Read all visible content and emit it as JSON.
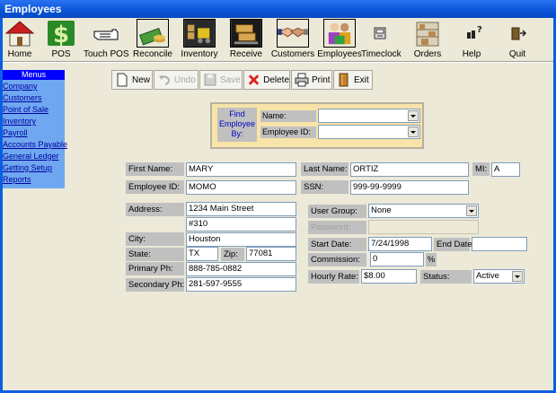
{
  "window": {
    "title": "Employees"
  },
  "toolbar": {
    "items": [
      {
        "label": "Home",
        "icon": "house-icon"
      },
      {
        "label": "POS",
        "icon": "dollar-icon"
      },
      {
        "label": "Touch POS",
        "icon": "pointing-hand-icon"
      },
      {
        "label": "Reconcile",
        "icon": "money-stack-icon"
      },
      {
        "label": "Inventory",
        "icon": "forklift-icon"
      },
      {
        "label": "Receive",
        "icon": "boxes-icon"
      },
      {
        "label": "Customers",
        "icon": "handshake-icon"
      },
      {
        "label": "Employees",
        "icon": "people-icon"
      },
      {
        "label": "Timeclock",
        "icon": "clock-icon"
      },
      {
        "label": "Orders",
        "icon": "shelf-icon"
      },
      {
        "label": "Help",
        "icon": "help-icon"
      },
      {
        "label": "Quit",
        "icon": "exit-door-icon"
      }
    ]
  },
  "sidebar": {
    "header": "Menus",
    "items": [
      "Company",
      "Customers",
      "Point of Sale",
      "Inventory",
      "Payroll",
      "Accounts Payable",
      "General Ledger",
      "Getting Setup",
      "Reports"
    ]
  },
  "record_toolbar": {
    "new": "New",
    "undo": "Undo",
    "save": "Save",
    "delete": "Delete",
    "print": "Print",
    "exit": "Exit"
  },
  "find": {
    "title": "Find Employee By:",
    "name_label": "Name:",
    "name_value": "",
    "id_label": "Employee ID:",
    "id_value": ""
  },
  "form": {
    "first_name_label": "First Name:",
    "first_name": "MARY",
    "last_name_label": "Last Name:",
    "last_name": "ORTIZ",
    "mi_label": "MI:",
    "mi": "A",
    "employee_id_label": "Employee ID:",
    "employee_id": "MOMO",
    "ssn_label": "SSN:",
    "ssn": "999-99-9999",
    "address_label": "Address:",
    "address1": "1234 Main Street",
    "address2": "#310",
    "city_label": "City:",
    "city": "Houston",
    "state_label": "State:",
    "state": "TX",
    "zip_label": "Zip:",
    "zip": "77081",
    "primary_ph_label": "Primary Ph:",
    "primary_ph": "888-785-0882",
    "secondary_ph_label": "Secondary Ph:",
    "secondary_ph": "281-597-9555",
    "user_group_label": "User Group:",
    "user_group": "None",
    "password_label": "Password:",
    "password": "",
    "start_date_label": "Start Date:",
    "start_date": "7/24/1998",
    "end_date_label": "End Date",
    "end_date": "",
    "commission_label": "Commission:",
    "commission": "0",
    "commission_unit": "%",
    "hourly_rate_label": "Hourly Rate:",
    "hourly_rate": "$8.00",
    "status_label": "Status:",
    "status": "Active"
  },
  "colors": {
    "titlebar": "#0a54d8",
    "client_bg": "#ece9d8",
    "sidebar_bg": "#6fa8f0",
    "menus_header": "#0000ff",
    "find_box_bg": "#f8e4a8",
    "label_bg": "#c0c0c0"
  }
}
